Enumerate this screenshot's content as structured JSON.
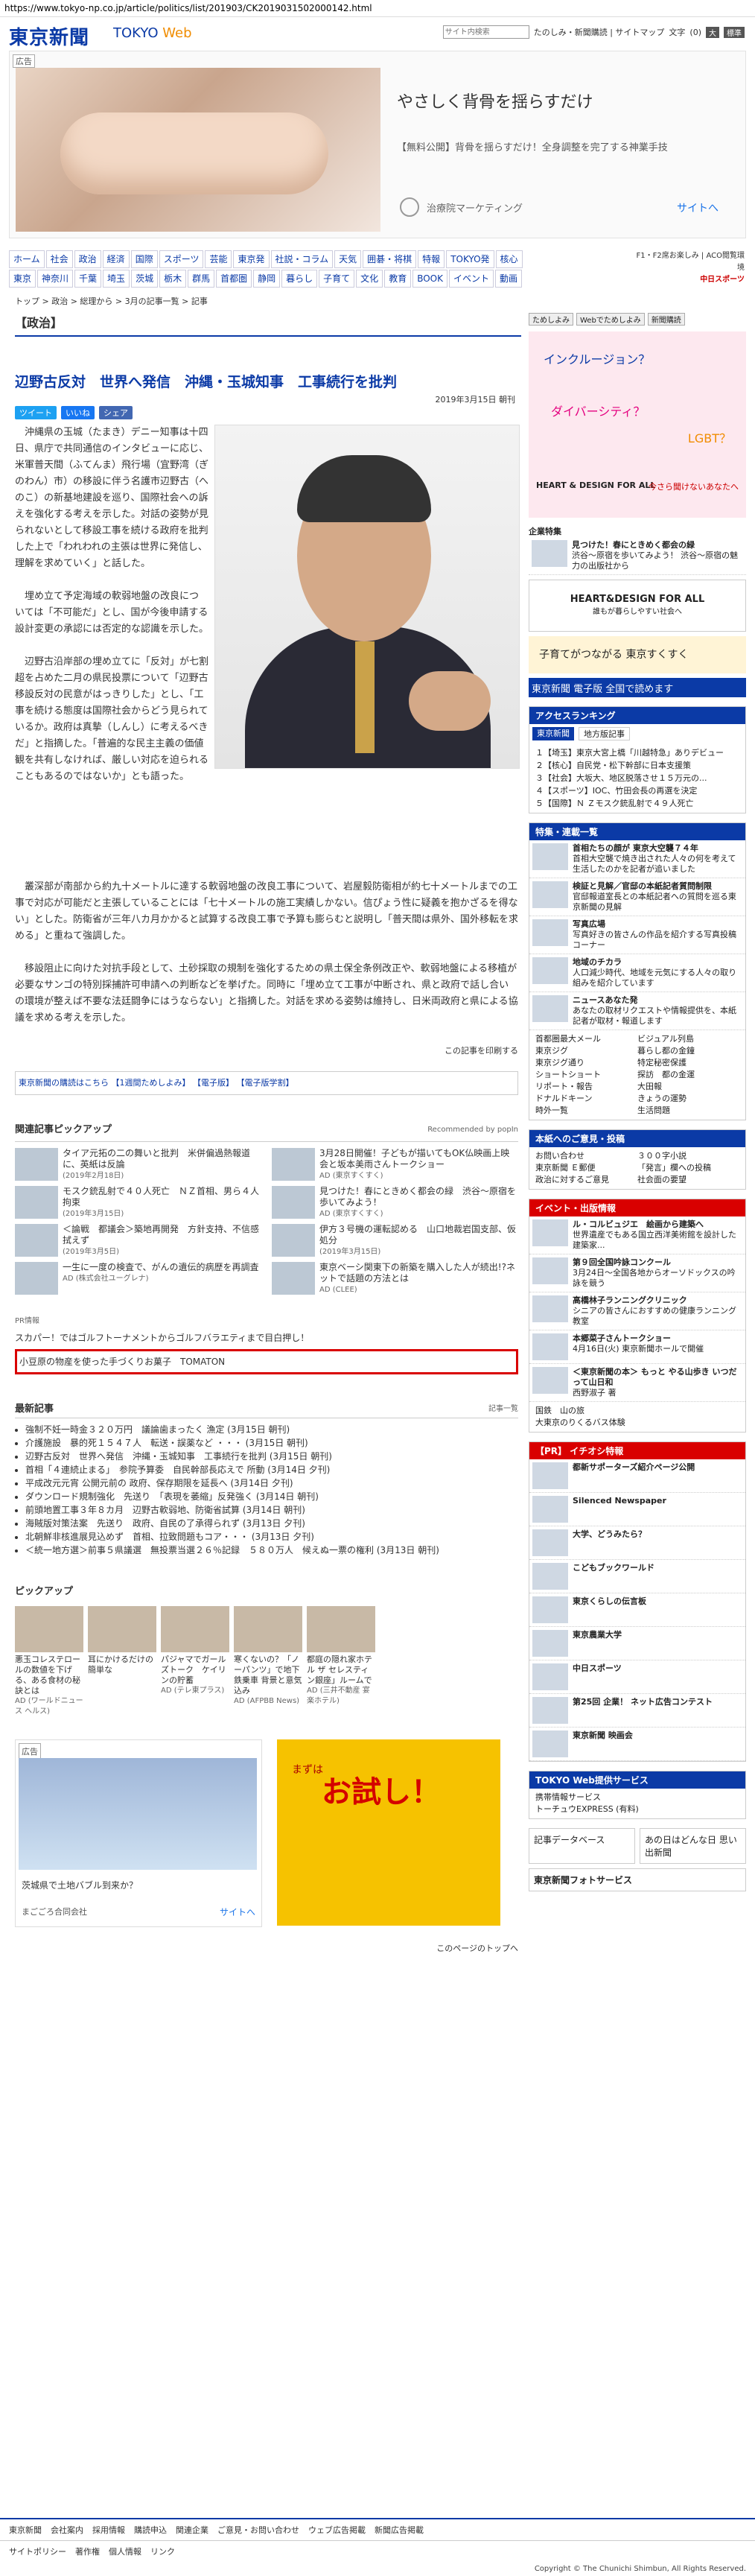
{
  "url": "https://www.tokyo-np.co.jp/article/politics/list/201903/CK2019031502000142.html",
  "header": {
    "logo": "東京新聞",
    "logo_web_prefix": "TOKYO",
    "logo_web_suffix": "Web",
    "search_placeholder": "サイト内検索",
    "links": "たのしみ・新聞購読 | サイトマップ",
    "font_size_label": "文字",
    "font_small": "(0)",
    "font_large": "大",
    "font_standard": "標準"
  },
  "ad_top": {
    "label": "広告",
    "headline": "やさしく背骨を揺らすだけ",
    "sub": "【無料公開】背骨を揺らすだけ！全身調整を完了する神業手技",
    "advertiser": "治療院マーケティング",
    "site": "サイトへ"
  },
  "nav": {
    "row1": [
      "ホーム",
      "社会",
      "政治",
      "経済",
      "国際",
      "スポーツ",
      "芸能",
      "東京発",
      "社説・コラム",
      "天気",
      "囲碁・将棋",
      "特報",
      "TOKYO発",
      "核心"
    ],
    "row2": [
      "東京",
      "神奈川",
      "千葉",
      "埼玉",
      "茨城",
      "栃木",
      "群馬",
      "首都圏",
      "静岡",
      "暮らし",
      "子育て",
      "文化",
      "教育",
      "BOOK",
      "イベント",
      "動画"
    ],
    "right_line1": "F1・F2席お楽しみ | ACO閲覧環境",
    "right_line2": "中日スポーツ"
  },
  "breadcrumb": "トップ > 政治 > 総理から > 3月の記事一覧 > 記事",
  "article": {
    "section": "【政治】",
    "headline": "辺野古反対　世界へ発信　沖縄・玉城知事　工事続行を批判",
    "tweet": "ツイート",
    "like": "いいね",
    "share": "シェア",
    "date": "2019年3月15日 朝刊",
    "p1": "沖縄県の玉城（たまき）デニー知事は十四日、県庁で共同通信のインタビューに応じ、米軍普天間（ふてんま）飛行場（宜野湾（ぎのわん）市）の移設に伴う名護市辺野古（へのこ）の新基地建設を巡り、国際社会への訴えを強化する考えを示した。対話の姿勢が見られないとして移設工事を続ける政府を批判した上で「われわれの主張は世界に発信し、理解を求めていく」と話した。",
    "p2": "埋め立て予定海域の軟弱地盤の改良については「不可能だ」とし、国が今後申請する設計変更の承認には否定的な認識を示した。",
    "p3": "辺野古沿岸部の埋め立てに「反対」が七割超を占めた二月の県民投票について「辺野古移設反対の民意がはっきりした」とし、「工事を続ける態度は国際社会からどう見られているか。政府は真摯（しんし）に考えるべきだ」と指摘した。「普遍的な民主主義の価値観を共有しなければ、厳しい対応を迫られることもあるのではないか」とも語った。",
    "p4": "叢深部が南部から約九十メートルに達する軟弱地盤の改良工事について、岩屋毅防衛相が約七十メートルまでの工事で対応が可能だと主張していることには「七十メートルの施工実績しかない。信ぴょう性に疑義を抱かざるを得ない」とした。防衛省が三年八カ月かかると試算する改良工事で予算も膨らむと説明し「普天間は県外、国外移転を求める」と重ねて強調した。",
    "p5": "移設阻止に向けた対抗手段として、土砂採取の規制を強化するための県土保全条例改正や、軟弱地盤による移植が必要なサンゴの特別採捕許可申請への判断などを挙げた。同時に「埋め立て工事が中断され、県と政府で話し合いの環境が整えば不要な法廷闘争にはうならない」と指摘した。対話を求める姿勢は維持し、日米両政府と県による協議を求める考えを示した。",
    "print_link": "この記事を印刷する"
  },
  "links_row": "東京新聞の購読はこちら 【1週間ためしよみ】 【電子版】 【電子版学割】",
  "related": {
    "title": "関連記事ピックアップ",
    "recommended_by": "Recommended by popIn",
    "items": [
      {
        "title": "タイア元拓の二の舞いと批判　米併偏過熱報道に、英紙は反論",
        "date": "(2019年2月18日)"
      },
      {
        "title": "3月28日開催！子どもが描いてもOK仏映画上映会と坂本美雨さんトークショー",
        "date": "AD (東京すくすく)"
      },
      {
        "title": "モスク銃乱射で４０人死亡　ＮＺ首相、男ら４人拘束",
        "date": "(2019年3月15日)"
      },
      {
        "title": "見つけた！春にときめく都会の緑　渋谷～原宿を歩いてみよう！",
        "date": "AD (東京すくすく)"
      },
      {
        "title": "＜論戦　都議会＞築地再開発　方針支持、不信感拭えず",
        "date": "(2019年3月5日)"
      },
      {
        "title": "伊方３号機の運転認める　山口地裁岩国支部、仮処分",
        "date": "(2019年3月15日)"
      },
      {
        "title": "一生に一度の検査で、がんの遺伝的病歴を再調査",
        "date": "AD (株式会社ユーグレナ)"
      },
      {
        "title": "東京ベーシ関東下の新築を購入した人が続出!?ネットで話題の方法とは",
        "date": "AD (CLEE)"
      }
    ]
  },
  "pr_info": {
    "label": "PR情報",
    "line1": "スカパー！ではゴルフトーナメントからゴルフバラエティまで目白押し！",
    "line2": "小豆原の物産を使った手づくりお菓子　TOMATON"
  },
  "latest": {
    "title": "最新記事",
    "list_label": "記事一覧",
    "items": [
      "強制不妊一時金３２０万円　議論歯まったく 漁定 (3月15日 朝刊)",
      "介護施設　暴的死１５４７人　転送・誤薬など ・・・ (3月15日 朝刊)",
      "辺野古反対　世界へ発信　沖縄・玉城知事　工事続行を批判 (3月15日 朝刊)",
      "首相「４連続止まる」　参院予算委　自民幹部長応えで 所動 (3月14日 夕刊)",
      "平成改元元宵 公開元前の 政府、保存期限を延長へ (3月14日 夕刊)",
      "ダウンロード規制強化　先送り　「表現を萎縮」反発強く (3月14日 朝刊)",
      "前頭地置工事３年８カ月　辺野古軟弱地、防衛省試算 (3月14日 朝刊)",
      "海賊版対策法案　先送り　政府、自民の了承得られず (3月13日 夕刊)",
      "北朝鮮非核進展見込めず　首相、拉致問題もコア・・・ (3月13日 夕刊)",
      "＜統一地方選＞前事５県議選　無投票当選２６％記録　５８０万人　候えぬ一票の権利 (3月13日 朝刊)"
    ]
  },
  "pickup": {
    "title": "ピックアップ",
    "items": [
      {
        "title": "悪玉コレステロールの数値を下げる、ある食材の秘訣とは",
        "source": "AD (ワールドニュース ヘルス)"
      },
      {
        "title": "耳にかけるだけの簡単な"
      },
      {
        "title": "パジャマでガールズトーク　ケイリンの貯蓄",
        "source": "AD (テレ東プラス)"
      },
      {
        "title": "寒くないの？「ノーパンツ」で地下鉄乗車 背景と意気込み",
        "source": "AD (AFPBB News)"
      },
      {
        "title": "都庭の隠れ家ホテル ザ セレスティン銀座」ルームで",
        "source": "AD (三井不動産 宴楽ホテル)"
      }
    ]
  },
  "ad_bottom": {
    "label": "広告",
    "caption": "茨城県で土地バブル到来か？",
    "advertiser": "まごごろ合同会社",
    "site": "サイトへ",
    "promo": "お試し！",
    "promo_sub": "まずは"
  },
  "page_top": "このページのトップへ",
  "sidebar": {
    "btn1": "ためしよみ",
    "btn2": "Webでためしよみ",
    "btn3": "新聞購読",
    "banner_q1": "インクルージョン？",
    "banner_q2": "ダイバーシティ？",
    "banner_q3": "LGBT？",
    "banner_brand": "HEART & DESIGN FOR ALL",
    "banner_cta": "今さら聞けないあなたへ",
    "corp_label": "企業特集",
    "corp_item": "見つけた！春にときめく都会の緑",
    "corp_desc": "渋谷～原宿を歩いてみよう！ 渋谷～原宿の魅力の出版社から",
    "hd_title": "HEART&DESIGN FOR ALL",
    "hd_sub": "誰もが暮らしやすい社会へ",
    "sukusuku": "子育てがつながる 東京すくすく",
    "denshi": "東京新聞 電子版 全国で読めます",
    "ranking_title": "アクセスランキング",
    "ranking_tab1": "東京新聞",
    "ranking_tab2": "地方版記事",
    "ranking": [
      "１【埼玉】東京大宮上橋「川越特急」ありデビュー",
      "２【核心】自民党・松下幹部に日本支援策",
      "３【社会】大坂大、地区脱落させ１５万元の...",
      "４【スポーツ】IOC、竹田会長の再選を決定",
      "５【国際】Ｎ Ｚモスク銃乱射で４９人死亡"
    ],
    "feature_title": "特集・連載一覧",
    "features": [
      {
        "title": "首相たちの顔が 東京大空襲７４年",
        "desc": "首相大空襲で焼き出された人々の何を考えて生活したのかを記者が追いました"
      },
      {
        "title": "検証と見解／官邸の本紙記者質問制限",
        "desc": "官邸報道室長との本紙記者への質問を巡る東京新聞の見解"
      },
      {
        "title": "写真広場",
        "desc": "写真好きの皆さんの作品を紹介する写真投稿コーナー"
      },
      {
        "title": "地域のチカラ",
        "desc": "人口減少時代、地域を元気にする人々の取り組みを紹介しています"
      },
      {
        "title": "ニュースあなた発",
        "desc": "あなたの取材リクエストや情報提供を、本紙記者が取材・報道します"
      }
    ],
    "feature_links": [
      "首都圏最大メール",
      "ビジュアル列島",
      "東京ジグ",
      "暮らし都の金鐘",
      "東京ジグ通り",
      "特定秘密保護",
      "ショートショート",
      "探訪　都の金運",
      "リポート・報告",
      "大田報",
      "ドナルドキーン",
      "きょうの運勢",
      "時外一覧",
      "生活問題"
    ],
    "corp_service_title": "本紙へのご意見・投稿",
    "service_links": [
      "お問い合わせ",
      "３００字小説",
      "東京新聞 Ｅ郵便",
      "「発言」欄への投稿",
      "政治に対するご意見",
      "社会面の要望"
    ],
    "event_title": "イベント・出版情報",
    "events": [
      {
        "title": "ル・コルビュジエ　絵画から建築へ",
        "desc": "世界遺産でもある国立西洋美術館を設計した建築家..."
      },
      {
        "title": "第９回全国吟詠コンクール",
        "desc": "3月24日～全国各地からオーソドックスの吟詠を競う"
      },
      {
        "title": "高橋林子ランニングクリニック",
        "desc": "シニアの皆さんにおすすめの健康ランニング教室"
      },
      {
        "title": "本郷菜子さんトークショー",
        "desc": "4月16日(火) 東京新聞ホールで開催"
      },
      {
        "title": "＜東京新聞の本＞ もっと やる山歩き いつだって山日和",
        "desc": "西野淑子 著"
      }
    ],
    "event_links": [
      "国鉄　山の旅",
      "大東京のりくるバス体験"
    ],
    "ad_title": "【PR】 イチオシ特報",
    "ads": [
      {
        "title": "都新サポーターズ紹介ページ公開",
        "desc": ""
      },
      {
        "title": "Silenced Newspaper",
        "desc": ""
      },
      {
        "title": "大学、どうみたら？",
        "desc": ""
      },
      {
        "title": "こどもブックワールド",
        "desc": ""
      },
      {
        "title": "東京くらしの伝言板",
        "desc": ""
      },
      {
        "title": "東京農業大学",
        "desc": ""
      },
      {
        "title": "中日スポーツ",
        "desc": ""
      },
      {
        "title": "第25回 企業！ ネット広告コンテスト",
        "desc": ""
      },
      {
        "title": "東京新聞 映画会",
        "desc": ""
      }
    ],
    "web_service_title": "TOKYO Web提供サービス",
    "web_services": [
      "携帯情報サービス",
      "トーチュウEXPRESS (有料)"
    ],
    "db_title": "記事データベース",
    "memories": "あの日はどんな日 思い出新聞",
    "photo_service": "東京新聞フォトサービス"
  },
  "footer": {
    "links": [
      "東京新聞",
      "会社案内",
      "採用情報",
      "購読申込",
      "関連企業",
      "ご意見・お問い合わせ",
      "ウェブ広告掲載",
      "新聞広告掲載"
    ],
    "links2": [
      "サイトポリシー",
      "著作権",
      "個人情報",
      "リンク"
    ],
    "copyright": "Copyright © The Chunichi Shimbun, All Rights Reserved."
  },
  "colors": {
    "brand": "#0b3aa6",
    "accent": "#f08c00",
    "alert": "#d90000"
  }
}
